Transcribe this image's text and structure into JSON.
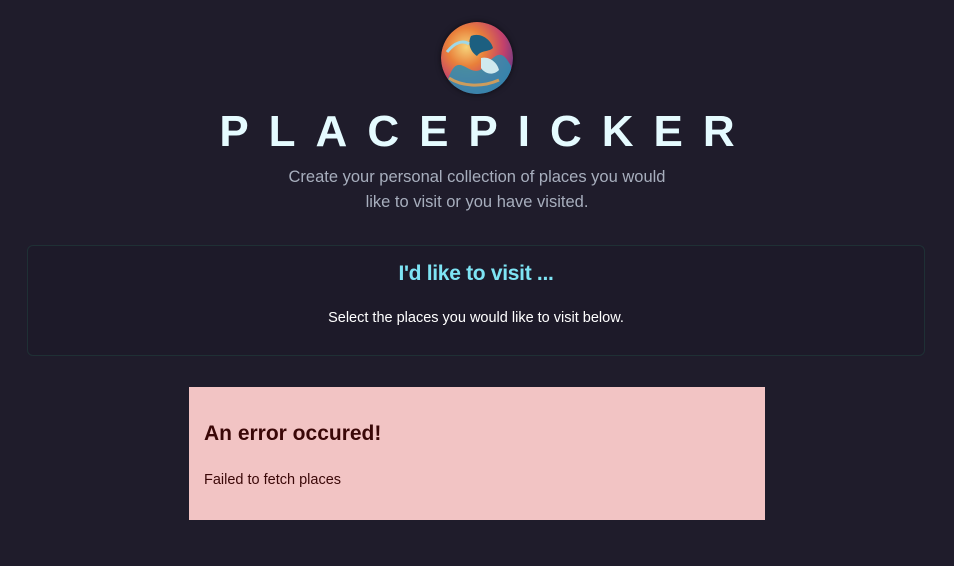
{
  "header": {
    "logo_icon": "globe-icon",
    "title": "PLACEPICKER",
    "subtitle": "Create your personal collection of places you would like to visit or you have visited."
  },
  "places_section": {
    "heading": "I'd like to visit ...",
    "fallback_text": "Select the places you would like to visit below."
  },
  "error_box": {
    "title": "An error occured!",
    "message": "Failed to fetch places"
  },
  "colors": {
    "background": "#1f1c2b",
    "title": "#e5fbff",
    "subtitle": "#a7aebd",
    "section_heading": "#7ee4f4",
    "error_background": "#f2c4c4",
    "error_text": "#3a0707"
  }
}
